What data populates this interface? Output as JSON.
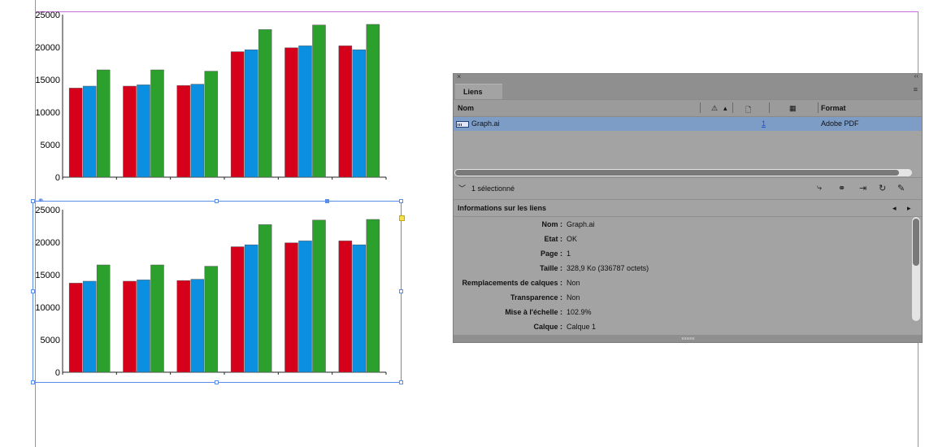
{
  "charts": [
    {
      "type": "bar",
      "categories": [
        "",
        "",
        "",
        "",
        "",
        ""
      ],
      "series": [
        {
          "values": [
            13700,
            14000,
            14100,
            19300,
            19900,
            20200
          ]
        },
        {
          "values": [
            14000,
            14200,
            14300,
            19600,
            20200,
            19600
          ]
        },
        {
          "values": [
            16500,
            16500,
            16300,
            22700,
            23400,
            23500
          ]
        }
      ],
      "yticks": [
        "0",
        "5000",
        "10000",
        "15000",
        "20000",
        "25000"
      ],
      "ylim": [
        0,
        25000
      ],
      "colors": [
        "#d7001b",
        "#0b8fe0",
        "#2ca02c"
      ]
    },
    {
      "type": "bar",
      "categories": [
        "",
        "",
        "",
        "",
        "",
        ""
      ],
      "series": [
        {
          "values": [
            13700,
            14000,
            14100,
            19300,
            19900,
            20200
          ]
        },
        {
          "values": [
            14000,
            14200,
            14300,
            19600,
            20200,
            19600
          ]
        },
        {
          "values": [
            16500,
            16500,
            16300,
            22700,
            23400,
            23500
          ]
        }
      ],
      "yticks": [
        "0",
        "5000",
        "10000",
        "15000",
        "20000",
        "25000"
      ],
      "ylim": [
        0,
        25000
      ],
      "colors": [
        "#d7001b",
        "#0b8fe0",
        "#2ca02c"
      ]
    }
  ],
  "chart_data": [
    {
      "type": "bar",
      "categories": [
        "",
        "",
        "",
        "",
        "",
        ""
      ],
      "series": [
        {
          "values": [
            13700,
            14000,
            14100,
            19300,
            19900,
            20200
          ]
        },
        {
          "values": [
            14000,
            14200,
            14300,
            19600,
            20200,
            19600
          ]
        },
        {
          "values": [
            16500,
            16500,
            16300,
            22700,
            23400,
            23500
          ]
        }
      ],
      "ylim": [
        0,
        25000
      ]
    },
    {
      "type": "bar",
      "categories": [
        "",
        "",
        "",
        "",
        "",
        ""
      ],
      "series": [
        {
          "values": [
            13700,
            14000,
            14100,
            19300,
            19900,
            20200
          ]
        },
        {
          "values": [
            14000,
            14200,
            14300,
            19600,
            20200,
            19600
          ]
        },
        {
          "values": [
            16500,
            16500,
            16300,
            22700,
            23400,
            23500
          ]
        }
      ],
      "ylim": [
        0,
        25000
      ]
    }
  ],
  "panel": {
    "close_glyph": "×",
    "collapse_glyph": "‹‹",
    "tab_label": "Liens",
    "menu_glyph": "≡",
    "columns": {
      "name": "Nom",
      "warn_icon": "⚠",
      "sort_glyph": "▴",
      "page_icon": "🗋",
      "grid_icon": "▦",
      "format": "Format"
    },
    "link": {
      "name": "Graph.ai",
      "page": "1",
      "format": "Adobe PDF"
    },
    "status": {
      "chevron": "﹀",
      "selected_text": "1 sélectionné"
    },
    "toolbar_icons": [
      "relink-icon",
      "go-to-link-icon",
      "update-link-icon",
      "refresh-icon",
      "edit-original-icon"
    ],
    "toolbar_glyphs": [
      "⤷",
      "⚭",
      "⇥",
      "↻",
      "✎"
    ],
    "info_title": "Informations sur les liens",
    "info_nav": [
      "◂",
      "▸"
    ],
    "info": [
      {
        "k": "Nom :",
        "v": "Graph.ai"
      },
      {
        "k": "Etat :",
        "v": "OK"
      },
      {
        "k": "Page :",
        "v": "1"
      },
      {
        "k": "Taille :",
        "v": "328,9 Ko (336787 octets)"
      },
      {
        "k": "Remplacements de calques :",
        "v": "Non"
      },
      {
        "k": "Transparence :",
        "v": "Non"
      },
      {
        "k": "Mise à l'échelle :",
        "v": "102.9%"
      },
      {
        "k": "Calque :",
        "v": "Calque 1"
      }
    ]
  }
}
